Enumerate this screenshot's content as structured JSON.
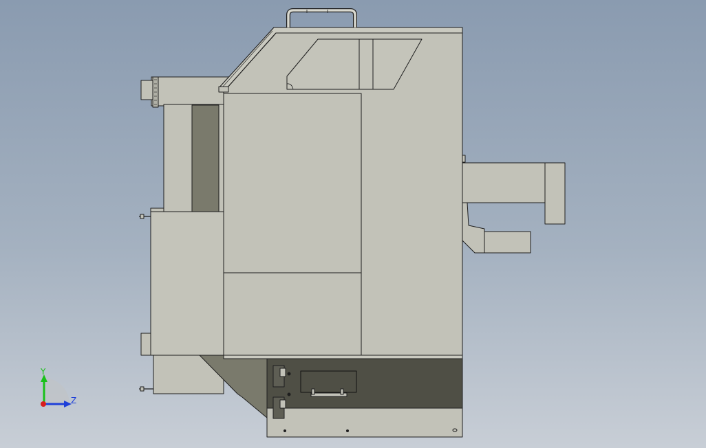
{
  "scene": {
    "background_top": "#8a9bb0",
    "background_bottom": "#c8ced6"
  },
  "palette": {
    "body": "#c2c2b8",
    "body_light": "#cacac0",
    "body_dark": "#b9b9ae",
    "recess": "#7a7a6c",
    "panel_dark": "#4f4f45",
    "edge": "#1e1e1e"
  },
  "triad": {
    "y_label": "Y",
    "z_label": "Z",
    "y_color": "#19c119",
    "z_color": "#1e3fd9",
    "x_color": "#d81e1e"
  }
}
